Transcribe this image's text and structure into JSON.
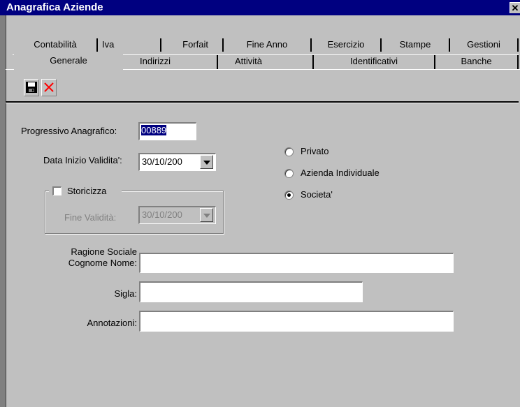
{
  "window": {
    "title": "Anagrafica Aziende",
    "close_glyph": "✕"
  },
  "tabs_row1": [
    "Contabilità",
    "Iva",
    "Forfait",
    "Fine Anno",
    "Esercizio",
    "Stampe",
    "Gestioni"
  ],
  "tabs_row2": [
    "Generale",
    "Indirizzi",
    "Attività",
    "Identificativi",
    "Banche"
  ],
  "active_tab": "Generale",
  "toolbar": {
    "save_icon": "floppy-disk",
    "delete_icon": "red-x"
  },
  "form": {
    "progressivo_label": "Progressivo Anagrafico:",
    "progressivo_value": "00889",
    "data_inizio_label": "Data Inizio Validita':",
    "data_inizio_value": "30/10/200",
    "storicizza_label": "Storicizza",
    "fine_validita_label": "Fine Validità:",
    "fine_validita_value": "30/10/200",
    "ragione_sociale_label_1": "Ragione Sociale",
    "ragione_sociale_label_2": "Cognome Nome:",
    "ragione_sociale_value": "",
    "sigla_label": "Sigla:",
    "sigla_value": "",
    "annotazioni_label": "Annotazioni:",
    "annotazioni_value": ""
  },
  "radios": {
    "options": [
      "Privato",
      "Azienda Individuale",
      "Societa'"
    ],
    "selected": "Societa'"
  },
  "colors": {
    "titlebar": "#000080",
    "face": "#c0c0c0",
    "delete_red": "#ff0000"
  }
}
